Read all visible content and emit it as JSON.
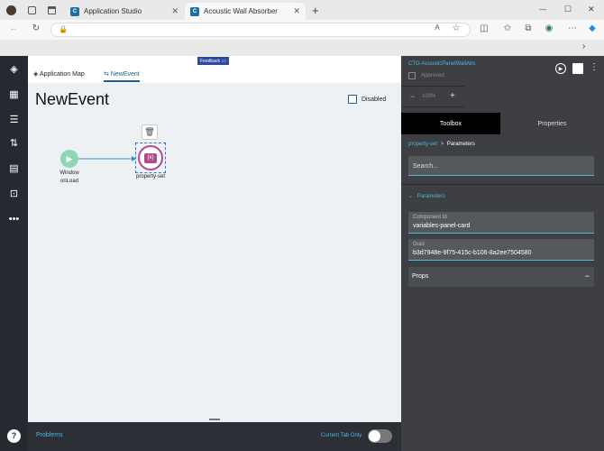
{
  "browser": {
    "tabs": [
      {
        "label": "Application Studio",
        "active": false
      },
      {
        "label": "Acoustic Wall Absorber",
        "active": true
      }
    ],
    "new_tab": "+",
    "window_controls": {
      "minimize": "—",
      "maximize": "☐",
      "close": "✕"
    }
  },
  "app": {
    "feedback_label": "Feedback",
    "tabs": [
      {
        "label": "Application Map",
        "active": false
      },
      {
        "label": "NewEvent",
        "active": true
      }
    ],
    "event_title": "NewEvent",
    "disabled_label": "Disabled",
    "nodes": {
      "start_label_1": "Window",
      "start_label_2": "onLoad",
      "action_label": "property-set"
    },
    "bottom": {
      "problems": "Problems",
      "current_tab_only": "Current Tab Only"
    }
  },
  "panel": {
    "title": "CTO-AcousticPanelWallAbs",
    "approved_label": "Approved",
    "zoom_minus": "−",
    "zoom_value": "100%",
    "zoom_plus": "+",
    "tab_toolbox": "Toolbox",
    "tab_properties": "Properties",
    "breadcrumb_link": "property-set",
    "breadcrumb_sep": ">",
    "breadcrumb_current": "Parameters",
    "search_placeholder": "Search...",
    "section_parameters": "Parameters",
    "component_id_label": "Component Id",
    "component_id_value": "variables-panel-card",
    "guid_label": "Guid",
    "guid_value": "b3d7948e-9f75-415c-b106-8a2ee7504580",
    "props_label": "Props",
    "props_toggle": "−"
  },
  "colors": {
    "accent": "#4fb3e6",
    "node_start": "#8fd6b5",
    "node_action": "#b14a8c",
    "panel_bg": "#3d3f42",
    "rail_bg": "#252a30"
  }
}
